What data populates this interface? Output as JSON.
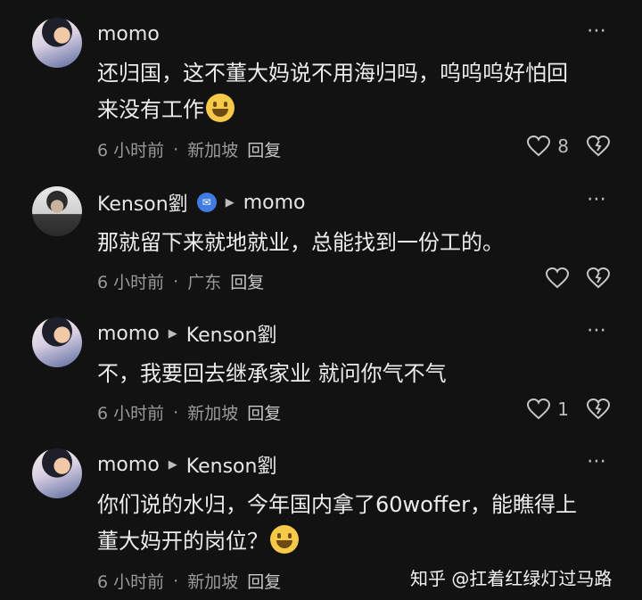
{
  "comments": [
    {
      "author": "momo",
      "reply_to": "",
      "text_lines": [
        "还归国，这不董大妈说不用海归吗，呜呜呜好怕回",
        "来没有工作"
      ],
      "emoji": "grinning-emoji",
      "time": "6 小时前",
      "location": "新加坡",
      "reply_label": "回复",
      "likes": "8"
    },
    {
      "author": "Kenson劉",
      "reply_to": "momo",
      "text_lines": [
        "那就留下来就地就业，总能找到一份工的。"
      ],
      "emoji": "",
      "time": "6 小时前",
      "location": "广东",
      "reply_label": "回复",
      "likes": ""
    },
    {
      "author": "momo",
      "reply_to": "Kenson劉",
      "text_lines": [
        "不，我要回去继承家业 就问你气不气"
      ],
      "emoji": "",
      "time": "6 小时前",
      "location": "新加坡",
      "reply_label": "回复",
      "likes": "1"
    },
    {
      "author": "momo",
      "reply_to": "Kenson劉",
      "text_lines": [
        "你们说的水归，今年国内拿了60woffer，能瞧得上",
        "董大妈开的岗位？"
      ],
      "emoji": "grinning-emoji",
      "time": "6 小时前",
      "location": "新加坡",
      "reply_label": "回复",
      "likes": ""
    }
  ],
  "separator": "·",
  "more_icon": "⋯",
  "watermark": "知乎 @扛着红绿灯过马路",
  "colors": {
    "background": "#121212",
    "badge": "#3f7be0"
  }
}
